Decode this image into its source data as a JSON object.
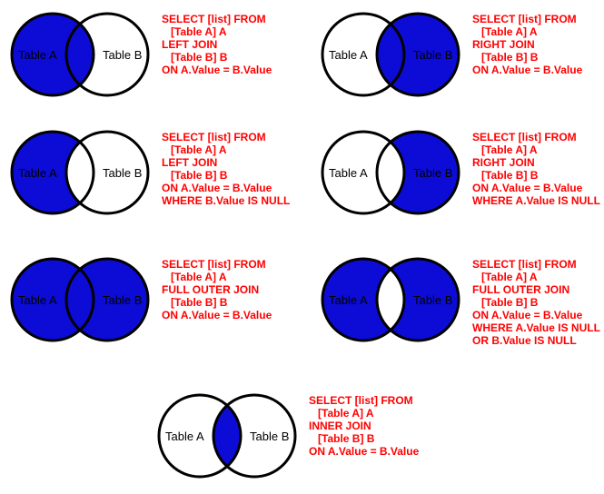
{
  "labels": {
    "table_a": "Table A",
    "table_b": "Table B"
  },
  "joins": {
    "left_join": {
      "sql": "SELECT [list] FROM\n   [Table A] A\nLEFT JOIN\n   [Table B] B\nON A.Value = B.Value",
      "fill": "left"
    },
    "right_join": {
      "sql": "SELECT [list] FROM\n   [Table A] A\nRIGHT JOIN\n   [Table B] B\nON A.Value = B.Value",
      "fill": "right"
    },
    "left_join_excl": {
      "sql": "SELECT [list] FROM\n   [Table A] A\nLEFT JOIN\n   [Table B] B\nON A.Value = B.Value\nWHERE B.Value IS NULL",
      "fill": "left_only"
    },
    "right_join_excl": {
      "sql": "SELECT [list] FROM\n   [Table A] A\nRIGHT JOIN\n   [Table B] B\nON A.Value = B.Value\nWHERE A.Value IS NULL",
      "fill": "right_only"
    },
    "full_outer": {
      "sql": "SELECT [list] FROM\n   [Table A] A\nFULL OUTER JOIN\n   [Table B] B\nON A.Value = B.Value",
      "fill": "both"
    },
    "full_outer_excl": {
      "sql": "SELECT [list] FROM\n   [Table A] A\nFULL OUTER JOIN\n   [Table B] B\nON A.Value = B.Value\nWHERE A.Value IS NULL\nOR B.Value IS NULL",
      "fill": "outer_only"
    },
    "inner_join": {
      "sql": "SELECT [list] FROM\n   [Table A] A\nINNER JOIN\n   [Table B] B\nON A.Value = B.Value",
      "fill": "intersection"
    }
  }
}
